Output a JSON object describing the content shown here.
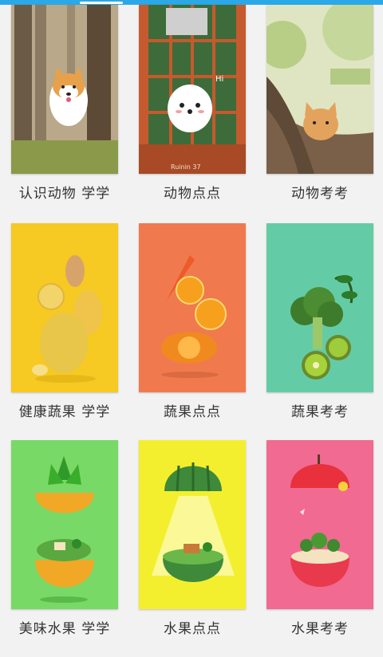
{
  "status_bar": {
    "accent": "#2aa8e8"
  },
  "rows": [
    {
      "cards": [
        {
          "label": "认识动物 学学",
          "icon": "dog-in-forest-illustration"
        },
        {
          "label": "动物点点",
          "icon": "puppy-in-phone-booth-illustration",
          "signature": "Ruinin 37",
          "caption": "Hi"
        },
        {
          "label": "动物考考",
          "icon": "cat-on-tree-illustration"
        }
      ]
    },
    {
      "cards": [
        {
          "label": "健康蔬果 学学",
          "icon": "stacked-fruits-yellow"
        },
        {
          "label": "蔬果点点",
          "icon": "carrot-orange-squash-stack"
        },
        {
          "label": "蔬果考考",
          "icon": "broccoli-kiwi-stack"
        }
      ]
    },
    {
      "cards": [
        {
          "label": "美味水果 学学",
          "icon": "pineapple-world-illustration"
        },
        {
          "label": "水果点点",
          "icon": "watermelon-world-illustration"
        },
        {
          "label": "水果考考",
          "icon": "apple-world-illustration"
        }
      ]
    }
  ]
}
